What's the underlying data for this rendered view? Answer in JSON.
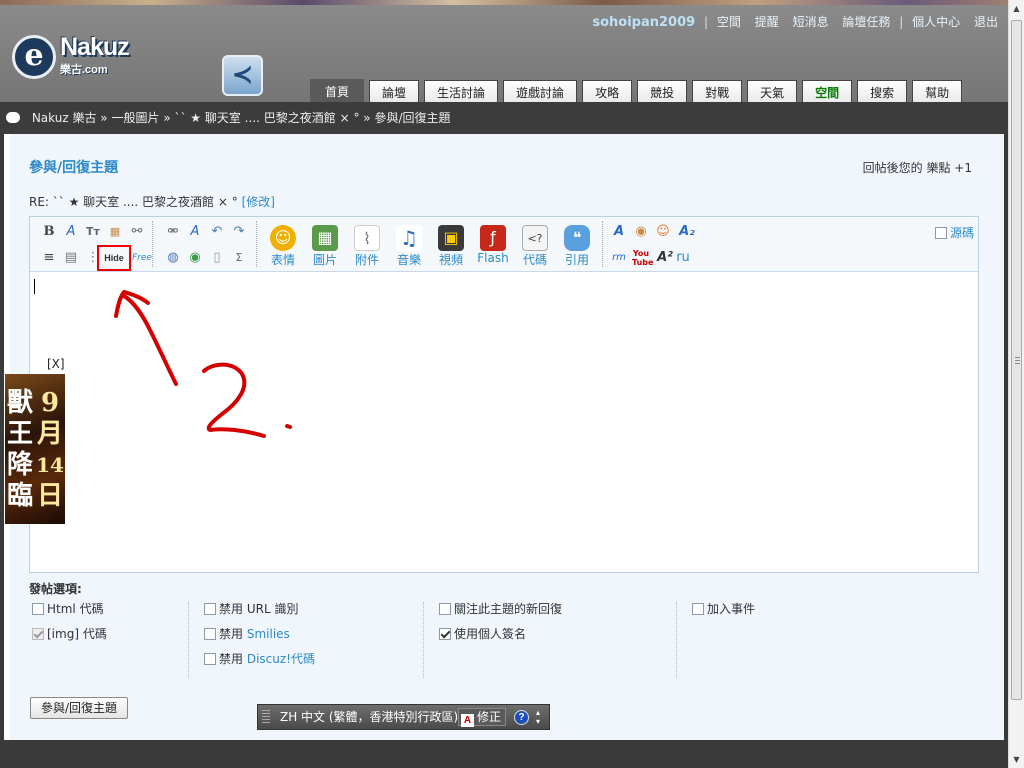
{
  "header": {
    "user": "sohoipan2009",
    "links": [
      "空間",
      "提醒",
      "短消息",
      "論壇任務",
      "個人中心",
      "退出"
    ],
    "logo_word": "Nakuz",
    "logo_sub": "樂古.com"
  },
  "nav": {
    "tabs": [
      "首頁",
      "論壇",
      "生活討論",
      "遊戲討論",
      "攻略",
      "競投",
      "對戰",
      "天氣",
      "空間",
      "搜索",
      "幫助"
    ],
    "active_tab": "首頁",
    "highlight_tab": "空間"
  },
  "breadcrumb": [
    "Nakuz 樂古",
    "一般圖片",
    "`` ★ 聊天室 .... 巴黎之夜酒館 × ° ",
    "參與/回復主題"
  ],
  "breadcrumb_sep": "»",
  "form": {
    "title": "參與/回復主題",
    "reward": "回帖後您的 樂點 +1",
    "subject_prefix": "RE: `` ★ 聊天室 .... 巴黎之夜酒館 × ° ",
    "edit_link": "[修改]"
  },
  "toolbar": {
    "hide_label": "Hide",
    "free_label": "Free",
    "big_buttons": [
      {
        "label": "表情",
        "icon": "smiley-icon",
        "color": "#f0b000",
        "glyph": "☺"
      },
      {
        "label": "圖片",
        "icon": "image-icon",
        "color": "#5a9a4a",
        "glyph": "▦"
      },
      {
        "label": "附件",
        "icon": "paperclip-icon",
        "color": "#8a8a8a",
        "glyph": "⌇"
      },
      {
        "label": "音樂",
        "icon": "music-icon",
        "color": "#2a6ac7",
        "glyph": "♫"
      },
      {
        "label": "視頻",
        "icon": "video-icon",
        "color": "#3a3a3a",
        "glyph": "▣"
      },
      {
        "label": "Flash",
        "icon": "flash-icon",
        "color": "#c8281a",
        "glyph": "ƒ"
      },
      {
        "label": "代碼",
        "icon": "code-icon",
        "color": "#9a9a9a",
        "glyph": "<?"
      },
      {
        "label": "引用",
        "icon": "quote-icon",
        "color": "#5aa0dc",
        "glyph": "❝"
      }
    ],
    "source_label": "源碼",
    "ru_label": "ru"
  },
  "options": {
    "title": "發帖選項:",
    "col1": [
      {
        "label": "Html 代碼",
        "checked": false,
        "disabled": false
      },
      {
        "label": "[img] 代碼",
        "checked": true,
        "disabled": true
      }
    ],
    "col2": [
      {
        "prefix": "禁用",
        "label": "URL 識別",
        "highlight": false,
        "checked": false
      },
      {
        "prefix": "禁用",
        "label": "Smilies",
        "highlight": true,
        "checked": false
      },
      {
        "prefix": "禁用",
        "label": "Discuz!代碼",
        "highlight": true,
        "checked": false
      }
    ],
    "col3": [
      {
        "label": "關注此主題的新回復",
        "checked": false
      },
      {
        "label": "使用個人簽名",
        "checked": true
      }
    ],
    "col4": [
      {
        "label": "加入事件",
        "checked": false
      }
    ]
  },
  "submit_label": "參與/回復主題",
  "ime": {
    "lang": "ZH 中文 (繁體，香港特別行政區)",
    "fix_label": "修正",
    "help": "?"
  },
  "ad": {
    "close": "[X]",
    "col1": "獸王降臨",
    "col2": [
      "9",
      "月",
      "14",
      "日"
    ]
  },
  "colors": {
    "accent": "#2d8ac7",
    "annotation": "#e00000"
  }
}
